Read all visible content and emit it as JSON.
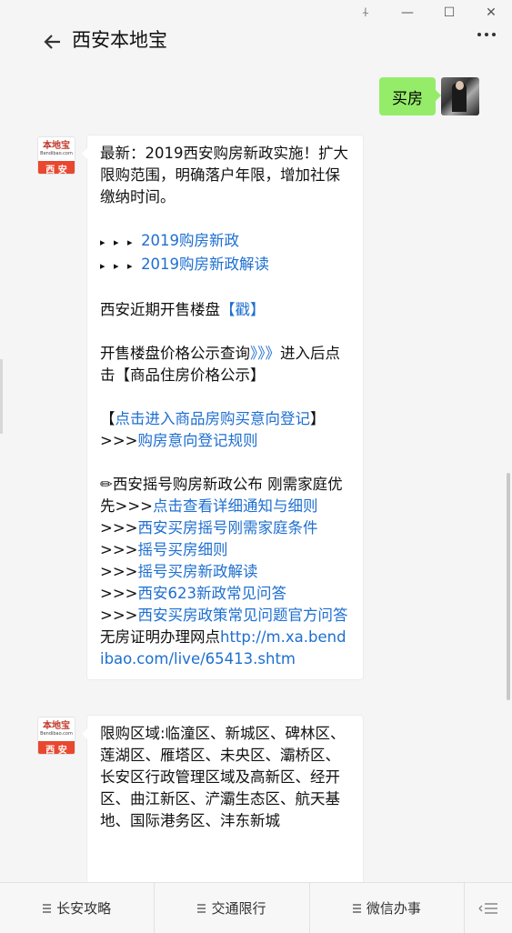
{
  "window": {
    "controls": [
      "⍭",
      "—",
      "☐",
      "✕"
    ]
  },
  "header": {
    "title": "西安本地宝"
  },
  "user_message": {
    "text": "买房"
  },
  "bot_avatar": {
    "name": "本地宝",
    "url": "Bendibao.com",
    "city": "西 安"
  },
  "message1": {
    "intro": "最新：2019西安购房新政实施！扩大限购范围，明确落户年限，增加社保缴纳时间。",
    "arrow_prefix": "▸ ▸ ▸ ",
    "link1": "2019购房新政",
    "link2": "2019购房新政解读",
    "recent_label": "西安近期开售楼盘",
    "recent_link": "【戳】",
    "price_label": "开售楼盘价格公示查询",
    "price_arrows": "》》》",
    "price_rest": "进入后点击【商品住房价格公示】",
    "register_open": "【",
    "register_link": "点击进入商品房购买意向登记",
    "register_close": "】",
    "gt": ">>>",
    "rules_link": "购房意向登记规则",
    "lottery_text": "✏西安摇号购房新政公布 刚需家庭优先>>>",
    "lottery_link": "点击查看详细通知与细则",
    "links": [
      "西安买房摇号刚需家庭条件",
      "摇号买房细则",
      "摇号买房新政解读",
      "西安623新政常见问答",
      "西安买房政策常见问题官方问答"
    ],
    "cert_label": "无房证明办理网点",
    "cert_link": "http://m.xa.bendibao.com/live/65413.shtm"
  },
  "message2": {
    "text": "限购区域:临潼区、新城区、碑林区、莲湖区、雁塔区、未央区、灞桥区、长安区行政管理区域及高新区、经开区、曲江新区、浐灞生态区、航天基地、国际港务区、沣东新城"
  },
  "bottom_menu": {
    "items": [
      "长安攻略",
      "交通限行",
      "微信办事"
    ]
  }
}
